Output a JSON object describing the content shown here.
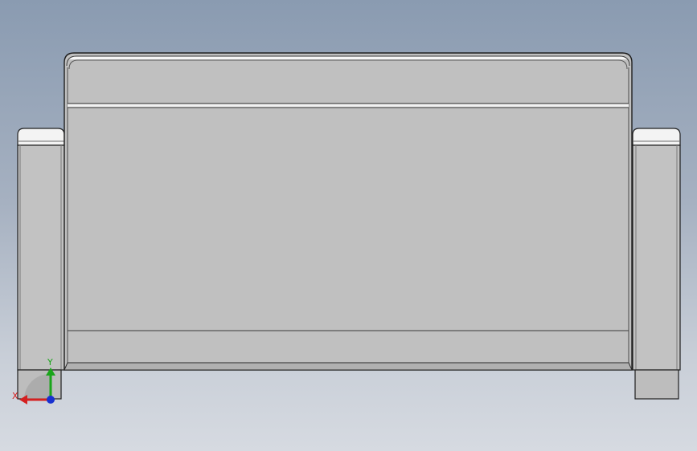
{
  "viewport": {
    "background_top": "#8a9bb1",
    "background_bottom": "#d6dae1"
  },
  "model": {
    "face_color": "#c0c0c0",
    "edge_color": "#1f1f1f",
    "highlight_color": "#f2f2f2"
  },
  "triad": {
    "x_label": "X",
    "y_label": "Y",
    "x_color": "#d42020",
    "y_color": "#1aa51a",
    "z_color": "#1830d0"
  }
}
